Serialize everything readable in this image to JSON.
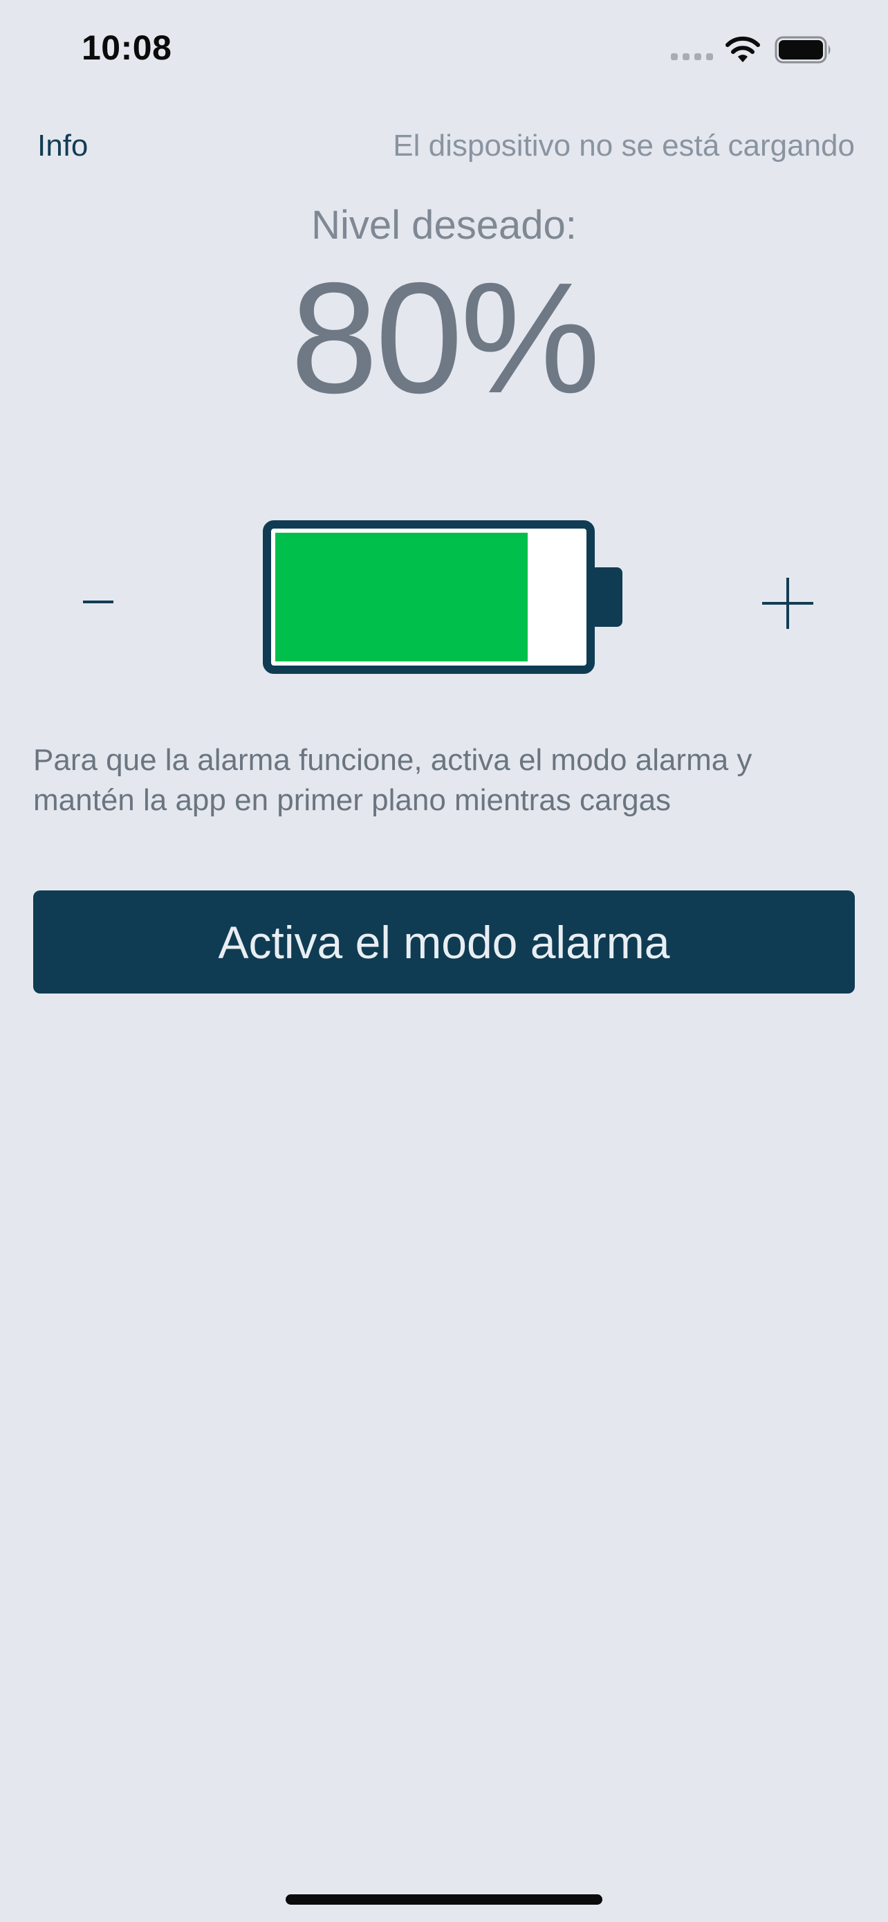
{
  "status_bar": {
    "time": "10:08",
    "icons": [
      "signal-icon",
      "wifi-icon",
      "battery-icon"
    ]
  },
  "header": {
    "info_label": "Info",
    "charging_status": "El dispositivo no se está cargando"
  },
  "target": {
    "label": "Nivel deseado:",
    "value": "80%",
    "level_fraction": 0.8
  },
  "controls": {
    "decrease_icon": "minus-icon",
    "increase_icon": "plus-icon"
  },
  "instructions": "Para que la alarma funcione, activa el modo alarma y mantén la app en primer plano mientras cargas",
  "alarm_button_label": "Activa el modo alarma",
  "colors": {
    "background": "#e4e8ee",
    "primary": "#0f3c53",
    "battery_fill": "#00c04b",
    "text_muted": "#7f8893"
  }
}
